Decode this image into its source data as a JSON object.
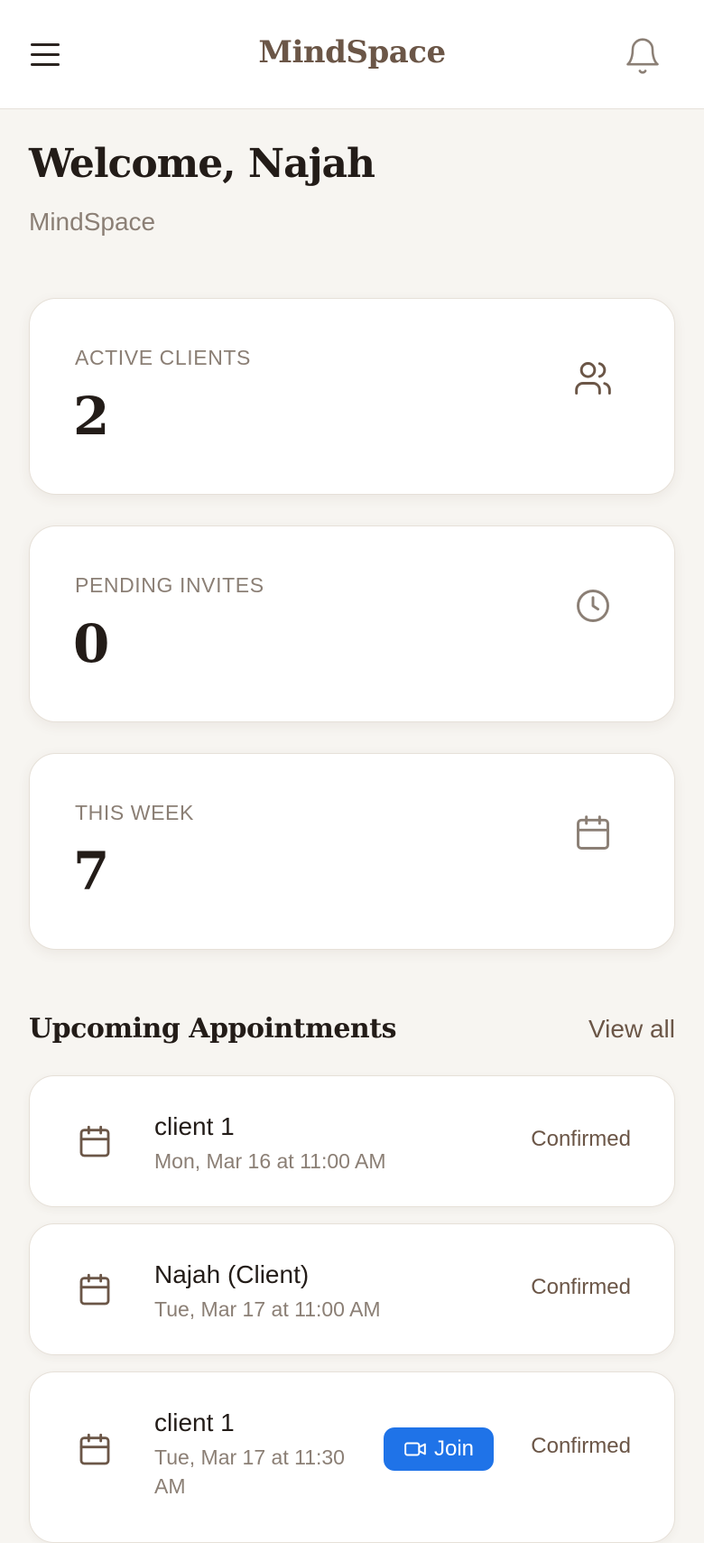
{
  "header": {
    "brand": "MindSpace",
    "menu_icon": "hamburger-menu-icon",
    "notification_icon": "bell-icon"
  },
  "welcome": {
    "title": "Welcome, Najah",
    "subtitle": "MindSpace"
  },
  "stats": [
    {
      "label": "ACTIVE CLIENTS",
      "value": "2",
      "icon": "users-icon"
    },
    {
      "label": "PENDING INVITES",
      "value": "0",
      "icon": "clock-icon"
    },
    {
      "label": "THIS WEEK",
      "value": "7",
      "icon": "calendar-icon"
    }
  ],
  "appointments": {
    "title": "Upcoming Appointments",
    "view_all": "View all",
    "items": [
      {
        "name": "client 1",
        "time": "Mon, Mar 16 at 11:00 AM",
        "status": "Confirmed"
      },
      {
        "name": "Najah (Client)",
        "time": "Tue, Mar 17 at 11:00 AM",
        "status": "Confirmed"
      },
      {
        "name": "client 1",
        "time_line1": "Tue, Mar 17 at 11:30",
        "time_line2": "AM",
        "status": "Confirmed",
        "join_label": "Join"
      }
    ]
  },
  "colors": {
    "background": "#f7f5f1",
    "brand": "#6b5647",
    "muted": "#8b7f75",
    "join_button": "#1f73e8"
  }
}
